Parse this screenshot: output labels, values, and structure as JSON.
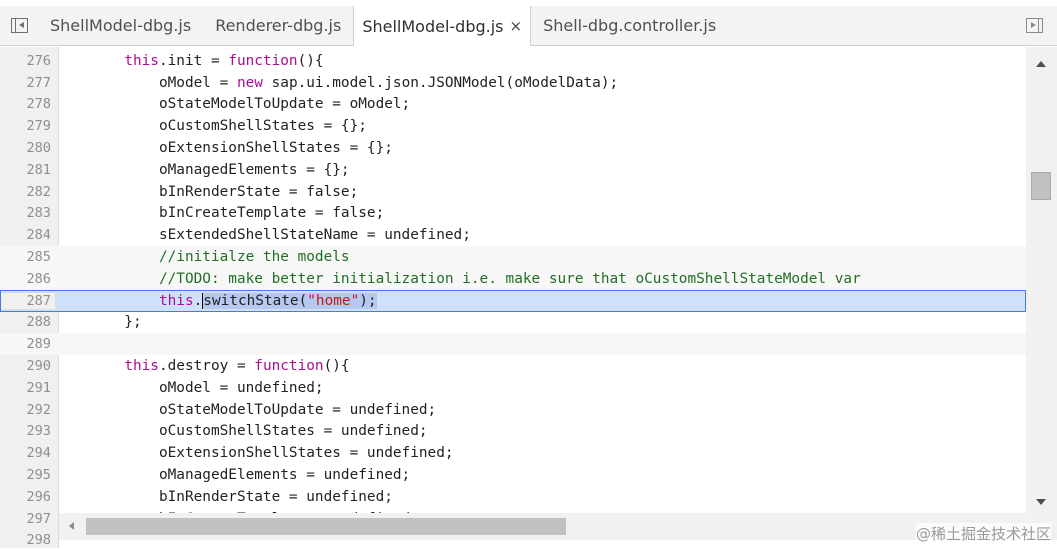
{
  "tabs": [
    {
      "label": "ShellModel-dbg.js",
      "active": false
    },
    {
      "label": "Renderer-dbg.js",
      "active": false
    },
    {
      "label": "ShellModel-dbg.js",
      "active": true,
      "close": "×"
    },
    {
      "label": "Shell-dbg.controller.js",
      "active": false
    }
  ],
  "editor": {
    "lines": [
      {
        "n": "276",
        "parts": [
          [
            "",
            "        "
          ],
          [
            "kw",
            "this"
          ],
          [
            "",
            ".init = "
          ],
          [
            "kw",
            "function"
          ],
          [
            "",
            "(){"
          ]
        ]
      },
      {
        "n": "277",
        "parts": [
          [
            "",
            "            oModel = "
          ],
          [
            "kw",
            "new"
          ],
          [
            "",
            " sap.ui.model.json.JSONModel(oModelData);"
          ]
        ]
      },
      {
        "n": "278",
        "parts": [
          [
            "",
            "            oStateModelToUpdate = oModel;"
          ]
        ]
      },
      {
        "n": "279",
        "parts": [
          [
            "",
            "            oCustomShellStates = {};"
          ]
        ]
      },
      {
        "n": "280",
        "parts": [
          [
            "",
            "            oExtensionShellStates = {};"
          ]
        ]
      },
      {
        "n": "281",
        "parts": [
          [
            "",
            "            oManagedElements = {};"
          ]
        ]
      },
      {
        "n": "282",
        "parts": [
          [
            "",
            "            bInRenderState = false;"
          ]
        ]
      },
      {
        "n": "283",
        "parts": [
          [
            "",
            "            bInCreateTemplate = false;"
          ]
        ]
      },
      {
        "n": "284",
        "parts": [
          [
            "",
            "            sExtendedShellStateName = undefined;"
          ]
        ]
      },
      {
        "n": "285",
        "parts": [
          [
            "",
            "            "
          ],
          [
            "cm",
            "//initialze the models"
          ]
        ]
      },
      {
        "n": "286",
        "parts": [
          [
            "",
            "            "
          ],
          [
            "cm",
            "//TODO: make better initialization i.e. make sure that oCustomShellStateModel var"
          ]
        ]
      },
      {
        "n": "287",
        "parts": [
          [
            "",
            "            "
          ],
          [
            "kw",
            "this"
          ],
          [
            "",
            "."
          ],
          [
            "caret",
            ""
          ],
          [
            "hl",
            "switchState("
          ],
          [
            "hlstr",
            "\"home\""
          ],
          [
            "hl",
            ");"
          ]
        ],
        "selected": true
      },
      {
        "n": "288",
        "parts": [
          [
            "",
            "        };"
          ]
        ]
      },
      {
        "n": "289",
        "parts": [
          [
            "",
            ""
          ]
        ]
      },
      {
        "n": "290",
        "parts": [
          [
            "",
            "        "
          ],
          [
            "kw",
            "this"
          ],
          [
            "",
            ".destroy = "
          ],
          [
            "kw",
            "function"
          ],
          [
            "",
            "(){"
          ]
        ]
      },
      {
        "n": "291",
        "parts": [
          [
            "",
            "            oModel = undefined;"
          ]
        ]
      },
      {
        "n": "292",
        "parts": [
          [
            "",
            "            oStateModelToUpdate = undefined;"
          ]
        ]
      },
      {
        "n": "293",
        "parts": [
          [
            "",
            "            oCustomShellStates = undefined;"
          ]
        ]
      },
      {
        "n": "294",
        "parts": [
          [
            "",
            "            oExtensionShellStates = undefined;"
          ]
        ]
      },
      {
        "n": "295",
        "parts": [
          [
            "",
            "            oManagedElements = undefined;"
          ]
        ]
      },
      {
        "n": "296",
        "parts": [
          [
            "",
            "            bInRenderState = undefined;"
          ]
        ]
      },
      {
        "n": "297",
        "parts": [
          [
            "",
            "            bInCreateTemplate = undefined;"
          ]
        ]
      },
      {
        "n": "298",
        "parts": [
          [
            "",
            ""
          ]
        ]
      }
    ]
  },
  "watermark": "@稀土掘金技术社区",
  "icons": {
    "navigator_toggle": "panel-left-icon",
    "debugger_toggle": "panel-right-icon",
    "close": "close-icon"
  },
  "colors": {
    "keyword": "#aa0d91",
    "string": "#c41a16",
    "comment": "#236e25",
    "selection_border": "#3d7ee8",
    "selection_bg": "#cfe0fa"
  }
}
